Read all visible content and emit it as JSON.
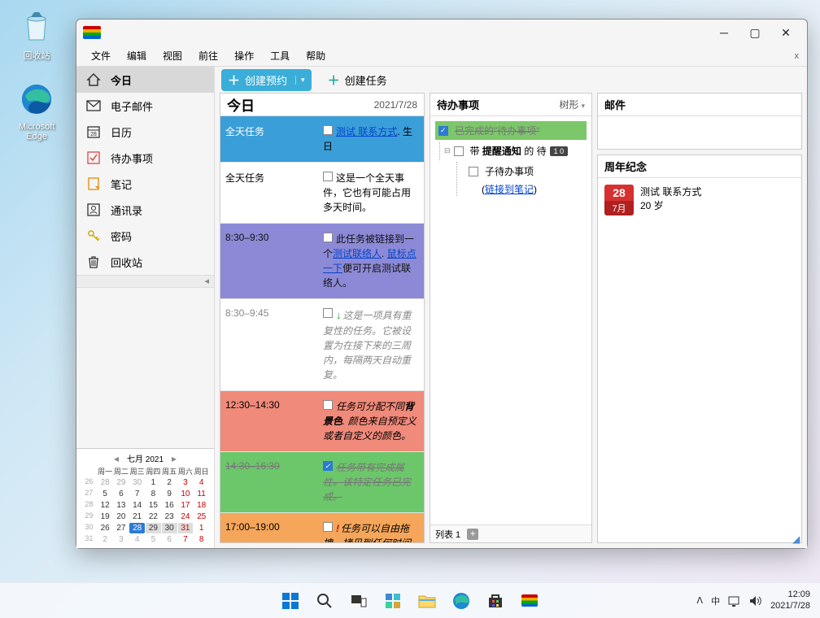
{
  "desktop": {
    "recycle_bin": "回收站",
    "edge": "Microsoft\nEdge"
  },
  "menus": [
    "文件",
    "编辑",
    "视图",
    "前往",
    "操作",
    "工具",
    "帮助"
  ],
  "nav": {
    "today": "今日",
    "mail": "电子邮件",
    "calendar": "日历",
    "todo": "待办事项",
    "notes": "笔记",
    "contacts": "通讯录",
    "password": "密码",
    "trash": "回收站"
  },
  "toolbar": {
    "create_appt": "创建预约",
    "create_task": "创建任务"
  },
  "today_pane": {
    "title": "今日",
    "date": "2021/7/28"
  },
  "events": {
    "allday1_label": "全天任务",
    "allday1_link": "测试 联系方式",
    "allday1_suffix": ". 生日",
    "allday2_label": "全天任务",
    "allday2_text": "这是一个全天事件，它也有可能占用多天时间。",
    "e3_time": "8:30–9:30",
    "e3_pre": "此任务被链接到一个",
    "e3_link1": "测试联络人",
    "e3_mid": ". ",
    "e3_link2": "鼠标点一下",
    "e3_post": "便可开启测试联络人。",
    "e4_time": "8:30–9:45",
    "e4_text": "这是一项具有重复性的任务。它被设置为在接下来的三周内，每隔两天自动重复。",
    "e5_time": "12:30–14:30",
    "e5_pre": "任务可分配不同",
    "e5_bold": "背景色",
    "e5_post": ". 颜色来自预定义或者自定义的颜色。",
    "e6_time": "14:30–16:30",
    "e6_text": "任务带有完成属性。该特定任务已完成。",
    "e7_time": "17:00–19:00",
    "e7_text": "任务可以自由拖拽、拷贝到任何时间段。您可以拖拽此任务到其他时段来体验此项"
  },
  "todo_pane": {
    "title": "待办事项",
    "view_mode": "树形",
    "item_done": "已完成的\"待办事项\"",
    "item_main_pre": "带 ",
    "item_main_bold": "提醒通知",
    "item_main_post": " 的 待",
    "badge": "1 0",
    "sub_label": "子待办事项",
    "sub_link": "链接到笔记",
    "footer_label": "列表 1"
  },
  "mail_pane": {
    "title": "邮件"
  },
  "anniv_pane": {
    "title": "周年纪念",
    "day": "28",
    "mon": "7月",
    "line1": "测试 联系方式",
    "line2": "20 岁"
  },
  "minical": {
    "month_label": "七月  2021",
    "weekdays": [
      "周一",
      "周二",
      "周三",
      "周四",
      "周五",
      "周六",
      "周日"
    ],
    "rows": [
      {
        "wn": "26",
        "days": [
          {
            "d": "28",
            "o": 1
          },
          {
            "d": "29",
            "o": 1
          },
          {
            "d": "30",
            "o": 1
          },
          {
            "d": "1"
          },
          {
            "d": "2"
          },
          {
            "d": "3",
            "r": 1
          },
          {
            "d": "4",
            "r": 1
          }
        ]
      },
      {
        "wn": "27",
        "days": [
          {
            "d": "5"
          },
          {
            "d": "6"
          },
          {
            "d": "7"
          },
          {
            "d": "8"
          },
          {
            "d": "9"
          },
          {
            "d": "10",
            "r": 1
          },
          {
            "d": "11",
            "r": 1
          }
        ]
      },
      {
        "wn": "28",
        "days": [
          {
            "d": "12"
          },
          {
            "d": "13"
          },
          {
            "d": "14"
          },
          {
            "d": "15"
          },
          {
            "d": "16"
          },
          {
            "d": "17",
            "r": 1
          },
          {
            "d": "18",
            "r": 1
          }
        ]
      },
      {
        "wn": "29",
        "days": [
          {
            "d": "19"
          },
          {
            "d": "20"
          },
          {
            "d": "21"
          },
          {
            "d": "22"
          },
          {
            "d": "23"
          },
          {
            "d": "24",
            "r": 1
          },
          {
            "d": "25",
            "r": 1
          }
        ]
      },
      {
        "wn": "30",
        "days": [
          {
            "d": "26"
          },
          {
            "d": "27"
          },
          {
            "d": "28",
            "t": 1
          },
          {
            "d": "29",
            "s": 1
          },
          {
            "d": "30",
            "s": 1
          },
          {
            "d": "31",
            "s": 1,
            "r": 1
          },
          {
            "d": "1",
            "o": 1,
            "r": 1
          }
        ]
      },
      {
        "wn": "31",
        "days": [
          {
            "d": "2",
            "o": 1
          },
          {
            "d": "3",
            "o": 1
          },
          {
            "d": "4",
            "o": 1
          },
          {
            "d": "5",
            "o": 1
          },
          {
            "d": "6",
            "o": 1
          },
          {
            "d": "7",
            "o": 1,
            "r": 1
          },
          {
            "d": "8",
            "o": 1,
            "r": 1
          }
        ]
      }
    ]
  },
  "systray": {
    "ime": "中",
    "time": "12:09",
    "date": "2021/7/28"
  }
}
